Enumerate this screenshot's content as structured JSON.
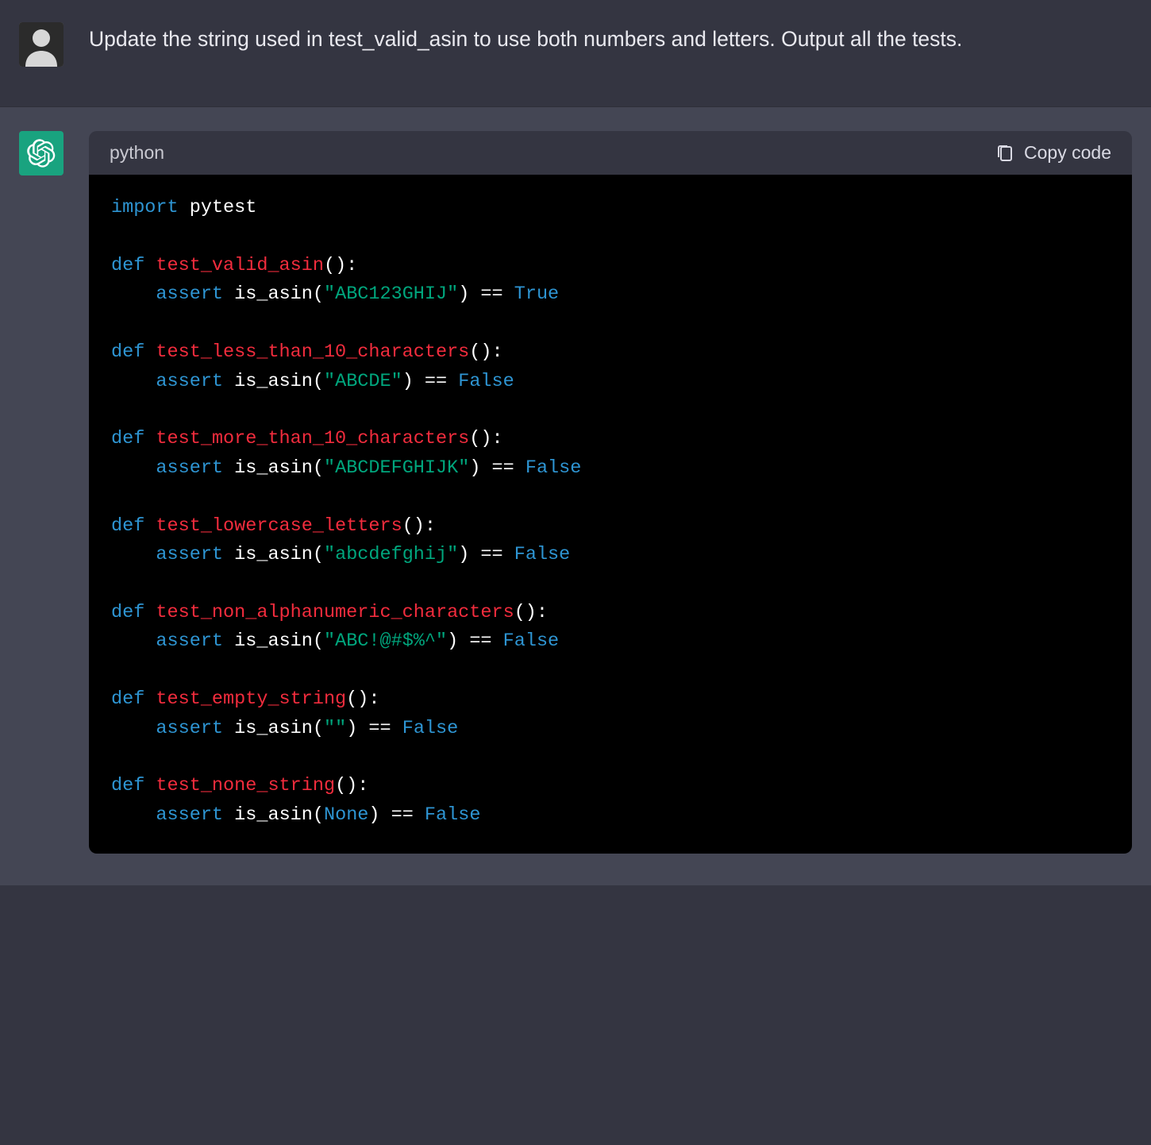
{
  "user": {
    "prompt": "Update the string used in test_valid_asin to use both numbers and letters. Output all the tests."
  },
  "code_header": {
    "language": "python",
    "copy_label": "Copy code"
  },
  "code": {
    "import_kw": "import",
    "import_mod": "pytest",
    "def_kw": "def",
    "assert_kw": "assert",
    "is_asin": "is_asin",
    "eqeq": "==",
    "true": "True",
    "false": "False",
    "none": "None",
    "tests": [
      {
        "name": "test_valid_asin",
        "arg": "\"ABC123GHIJ\"",
        "result": "True"
      },
      {
        "name": "test_less_than_10_characters",
        "arg": "\"ABCDE\"",
        "result": "False"
      },
      {
        "name": "test_more_than_10_characters",
        "arg": "\"ABCDEFGHIJK\"",
        "result": "False"
      },
      {
        "name": "test_lowercase_letters",
        "arg": "\"abcdefghij\"",
        "result": "False"
      },
      {
        "name": "test_non_alphanumeric_characters",
        "arg": "\"ABC!@#$%^\"",
        "result": "False"
      },
      {
        "name": "test_empty_string",
        "arg": "\"\"",
        "result": "False"
      },
      {
        "name": "test_none_string",
        "arg": "None",
        "result": "False"
      }
    ]
  }
}
